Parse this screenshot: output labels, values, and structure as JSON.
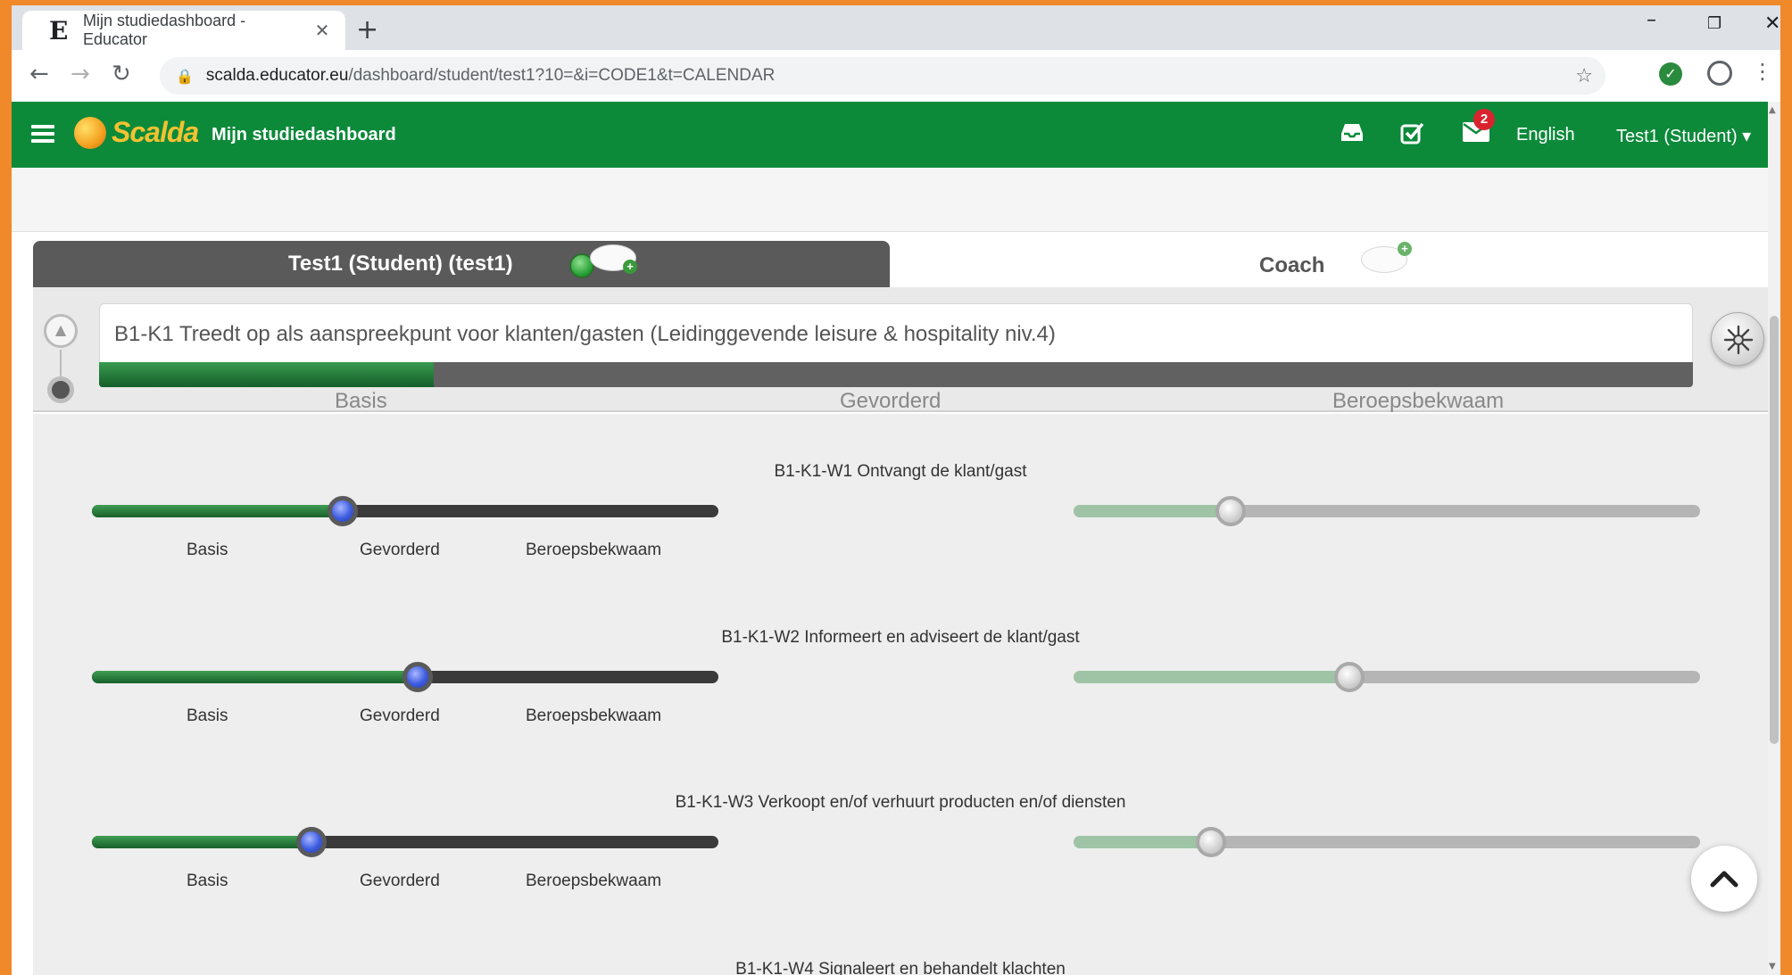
{
  "browser": {
    "tab_title": "Mijn studiedashboard - Educator",
    "tab_favicon": "E",
    "url_host": "scalda.educator.eu",
    "url_path": "/dashboard/student/test1?10=&i=CODE1&t=CALENDAR"
  },
  "app": {
    "logo_text": "Scalda",
    "title": "Mijn studiedashboard",
    "inbox_icon": "inbox-icon",
    "tasks_icon": "checkbox-edit-icon",
    "mail_icon": "envelope-icon",
    "mail_badge": "2",
    "language": "English",
    "user_menu": "Test1 (Student) ▾",
    "brand_color": "#0c8a3a"
  },
  "tabs": {
    "student": "Test1 (Student) (test1)",
    "coach": "Coach"
  },
  "competency": {
    "title": "B1-K1 Treedt op als aanspreekpunt voor klanten/gasten (Leidinggevende leisure & hospitality niv.4)",
    "progress": 0.21,
    "levels": [
      "Basis",
      "Gevorderd",
      "Beroepsbekwaam"
    ]
  },
  "work_processes": [
    {
      "title": "B1-K1-W1 Ontvangt de klant/gast",
      "student_value": 0.4,
      "coach_value": 0.25,
      "levels": [
        "Basis",
        "Gevorderd",
        "Beroepsbekwaam"
      ]
    },
    {
      "title": "B1-K1-W2 Informeert en adviseert de klant/gast",
      "student_value": 0.52,
      "coach_value": 0.44,
      "levels": [
        "Basis",
        "Gevorderd",
        "Beroepsbekwaam"
      ]
    },
    {
      "title": "B1-K1-W3 Verkoopt en/of verhuurt producten en/of diensten",
      "student_value": 0.35,
      "coach_value": 0.22,
      "levels": [
        "Basis",
        "Gevorderd",
        "Beroepsbekwaam"
      ]
    },
    {
      "title": "B1-K1-W4 Signaleert en behandelt klachten"
    }
  ]
}
